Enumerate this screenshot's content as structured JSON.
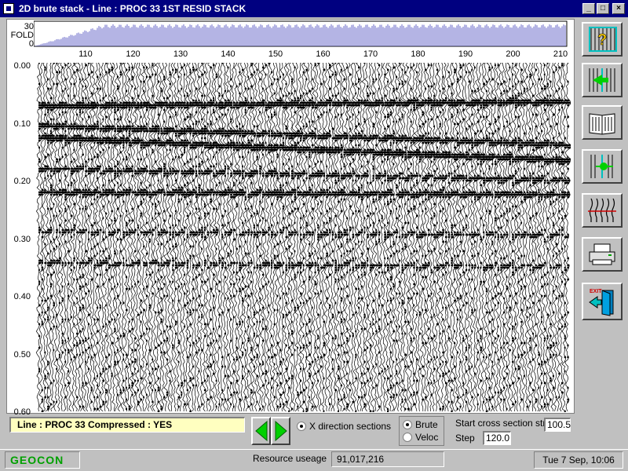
{
  "window": {
    "title": "2D brute stack - Line : PROC 33  1ST RESID STACK",
    "min_label": "_",
    "max_label": "□",
    "close_label": "×"
  },
  "fold": {
    "label_top": "30",
    "label_word": "FOLD",
    "label_bottom": "0"
  },
  "station_ticks": [
    "110",
    "120",
    "130",
    "140",
    "150",
    "160",
    "170",
    "180",
    "190",
    "200",
    "210"
  ],
  "time_ticks": [
    "0.00",
    "0.10",
    "0.20",
    "0.30",
    "0.40",
    "0.50",
    "0.60"
  ],
  "toolbar": {
    "icons": [
      "help-icon",
      "move-section-icon",
      "book-icon",
      "select-station-icon",
      "traces-icon",
      "printer-icon",
      "exit-icon"
    ],
    "exit_label": "EXIT"
  },
  "status": {
    "line_text": "Line : PROC 33   Compressed : YES"
  },
  "controls": {
    "x_direction_label": "X direction sections",
    "brute_label": "Brute",
    "veloc_label": "Veloc",
    "start_label": "Start cross section stn",
    "start_value": "100.5",
    "step_label": "Step",
    "step_value": "120.0"
  },
  "footer": {
    "brand": "GEOCON",
    "resource_label": "Resource useage",
    "resource_value": "91,017,216",
    "datetime": "Tue 7 Sep, 10:06"
  },
  "colors": {
    "titlebar": "#000080",
    "accent_green": "#00a000",
    "status_bg": "#ffffc0",
    "fold_fill": "#6a6ac8"
  }
}
